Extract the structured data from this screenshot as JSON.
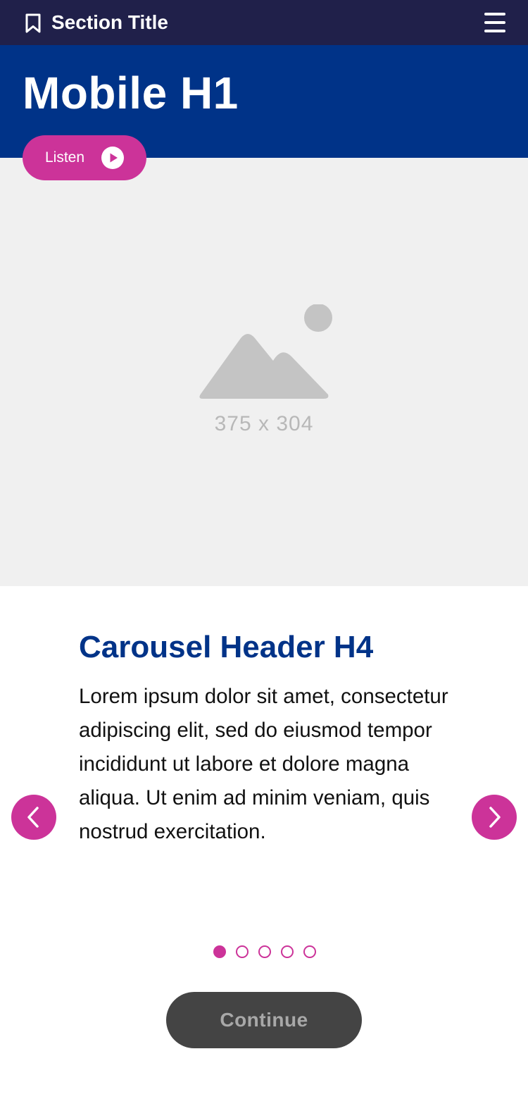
{
  "header": {
    "section_title": "Section Title",
    "bookmark_icon": "bookmark-icon",
    "menu_icon": "hamburger-menu-icon"
  },
  "hero": {
    "title": "Mobile H1"
  },
  "listen_button": {
    "label": "Listen",
    "icon": "play-icon"
  },
  "image": {
    "caption": "375 x 304",
    "icon": "image-placeholder-icon"
  },
  "carousel": {
    "header": "Carousel Header H4",
    "body": "Lorem ipsum dolor sit amet, consectetur adipiscing elit, sed do eiusmod tempor incididunt ut labore et dolore magna aliqua. Ut enim ad minim veniam, quis nostrud exercitation.",
    "prev_icon": "chevron-left-icon",
    "next_icon": "chevron-right-icon",
    "slide_count": 5,
    "active_slide": 1
  },
  "continue_button": {
    "label": "Continue"
  },
  "colors": {
    "topbar": "#20204a",
    "hero": "#003388",
    "accent": "#cc3399",
    "placeholder_bg": "#f0f0f0",
    "button_disabled": "#444444"
  }
}
